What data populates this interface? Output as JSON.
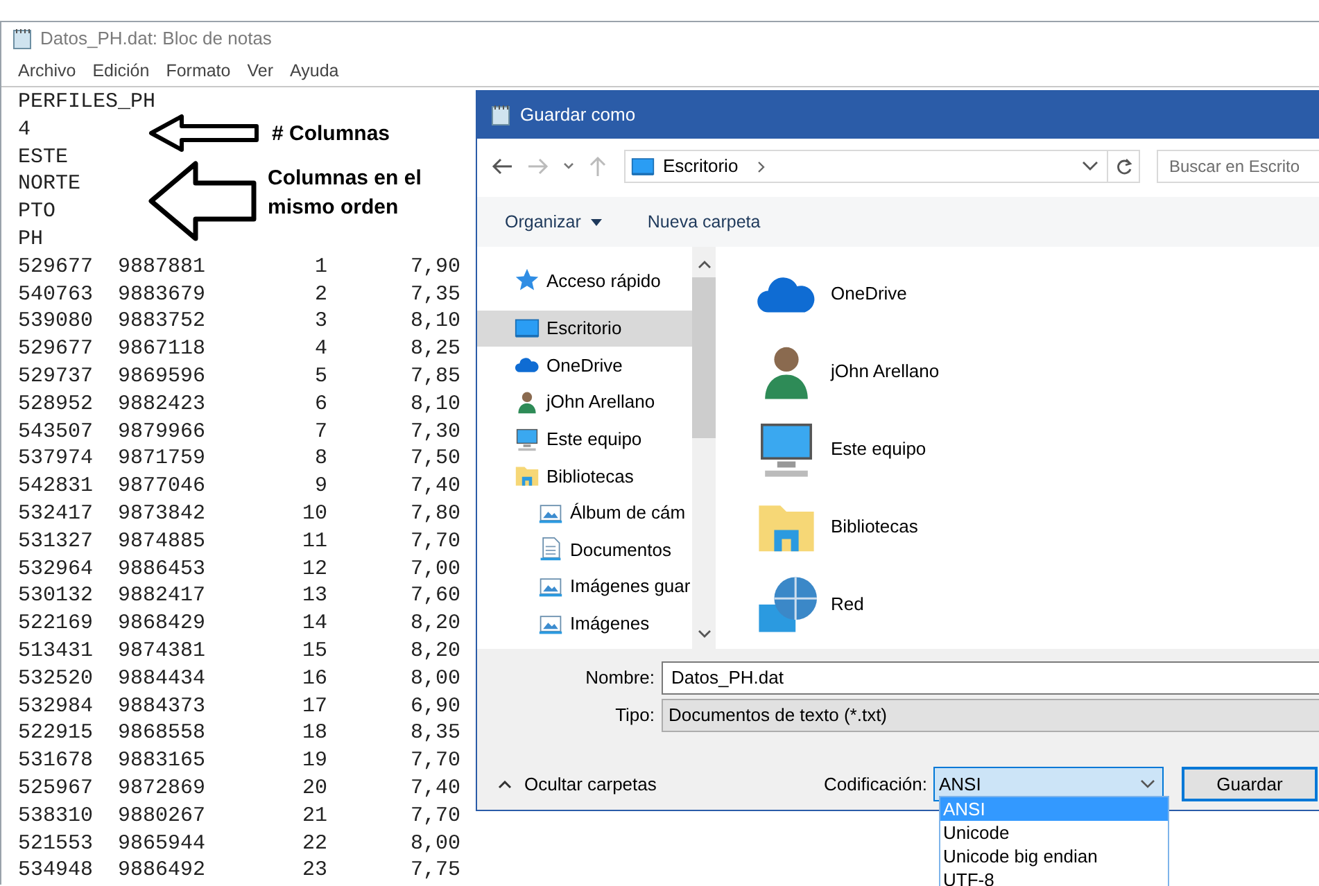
{
  "notepad": {
    "title": "Datos_PH.dat: Bloc de notas",
    "menu": [
      "Archivo",
      "Edición",
      "Formato",
      "Ver",
      "Ayuda"
    ],
    "header_lines": [
      "PERFILES_PH",
      "4",
      "ESTE",
      "NORTE",
      "PTO",
      "PH"
    ],
    "rows": [
      [
        "529677",
        "9887881",
        "1",
        "7,90"
      ],
      [
        "540763",
        "9883679",
        "2",
        "7,35"
      ],
      [
        "539080",
        "9883752",
        "3",
        "8,10"
      ],
      [
        "529677",
        "9867118",
        "4",
        "8,25"
      ],
      [
        "529737",
        "9869596",
        "5",
        "7,85"
      ],
      [
        "528952",
        "9882423",
        "6",
        "8,10"
      ],
      [
        "543507",
        "9879966",
        "7",
        "7,30"
      ],
      [
        "537974",
        "9871759",
        "8",
        "7,50"
      ],
      [
        "542831",
        "9877046",
        "9",
        "7,40"
      ],
      [
        "532417",
        "9873842",
        "10",
        "7,80"
      ],
      [
        "531327",
        "9874885",
        "11",
        "7,70"
      ],
      [
        "532964",
        "9886453",
        "12",
        "7,00"
      ],
      [
        "530132",
        "9882417",
        "13",
        "7,60"
      ],
      [
        "522169",
        "9868429",
        "14",
        "8,20"
      ],
      [
        "513431",
        "9874381",
        "15",
        "8,20"
      ],
      [
        "532520",
        "9884434",
        "16",
        "8,00"
      ],
      [
        "532984",
        "9884373",
        "17",
        "6,90"
      ],
      [
        "522915",
        "9868558",
        "18",
        "8,35"
      ],
      [
        "531678",
        "9883165",
        "19",
        "7,70"
      ],
      [
        "525967",
        "9872869",
        "20",
        "7,40"
      ],
      [
        "538310",
        "9880267",
        "21",
        "7,70"
      ],
      [
        "521553",
        "9865944",
        "22",
        "8,00"
      ],
      [
        "534948",
        "9886492",
        "23",
        "7,75"
      ]
    ]
  },
  "annotations": [
    {
      "kind": "small",
      "text": "# Columnas"
    },
    {
      "kind": "large",
      "text": "Columnas en el mismo orden"
    }
  ],
  "dialog": {
    "title": "Guardar como",
    "address": "Escritorio",
    "search": {
      "placeholder": "Buscar en Escrito"
    },
    "toolbar": [
      {
        "label": "Organizar",
        "dropdown": true
      },
      {
        "label": "Nueva carpeta",
        "dropdown": false
      }
    ],
    "nav_items": [
      {
        "kind": "star",
        "label": "Acceso rápido",
        "selected": false
      },
      {
        "kind": "desktop",
        "label": "Escritorio",
        "selected": true
      },
      {
        "kind": "cloud",
        "label": "OneDrive",
        "selected": false
      },
      {
        "kind": "user",
        "label": "jOhn Arellano",
        "selected": false
      },
      {
        "kind": "computer",
        "label": "Este equipo",
        "selected": false
      },
      {
        "kind": "library",
        "label": "Bibliotecas",
        "selected": false,
        "children": [
          {
            "kind": "pictures",
            "label": "Álbum de cám",
            "selected": false
          },
          {
            "kind": "document",
            "label": "Documentos",
            "selected": false
          },
          {
            "kind": "pictures",
            "label": "Imágenes guar",
            "selected": false
          },
          {
            "kind": "pictures",
            "label": "Imágenes",
            "selected": false
          }
        ]
      }
    ],
    "items": [
      {
        "kind": "cloud",
        "label": "OneDrive"
      },
      {
        "kind": "user",
        "label": "jOhn Arellano"
      },
      {
        "kind": "computer",
        "label": "Este equipo"
      },
      {
        "kind": "library",
        "label": "Bibliotecas"
      },
      {
        "kind": "globe",
        "label": "Red"
      }
    ],
    "filename_label": "Nombre:",
    "filename": "Datos_PH.dat",
    "type_label": "Tipo:",
    "type": "Documentos de texto (*.txt)",
    "hide_folders": "Ocultar carpetas",
    "encoding_label": "Codificación:",
    "encoding": "ANSI",
    "encoding_options": [
      {
        "label": "ANSI",
        "selected": true
      },
      {
        "label": "Unicode",
        "selected": false
      },
      {
        "label": "Unicode big endian",
        "selected": false
      },
      {
        "label": "UTF-8",
        "selected": false
      }
    ],
    "save_button": "Guardar"
  }
}
